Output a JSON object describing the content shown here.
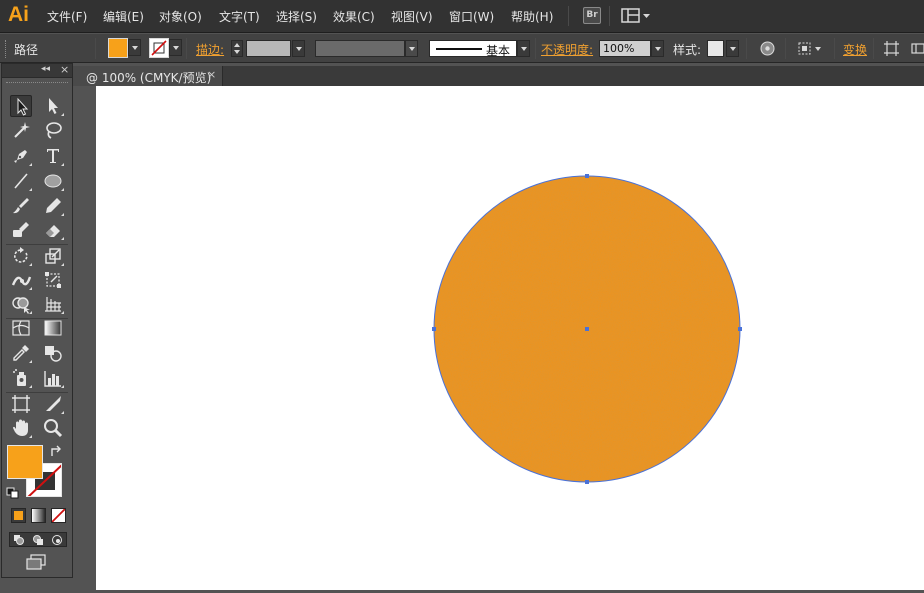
{
  "app": {
    "logo": "Ai",
    "bridge_label": "Br"
  },
  "menu": [
    "文件(F)",
    "编辑(E)",
    "对象(O)",
    "文字(T)",
    "选择(S)",
    "效果(C)",
    "视图(V)",
    "窗口(W)",
    "帮助(H)"
  ],
  "control_bar": {
    "selection_type": "路径",
    "fill_color": "#f7a11a",
    "stroke_label": "描边:",
    "stroke_profile_label": "基本",
    "opacity_label": "不透明度:",
    "opacity_value": "100%",
    "style_label": "样式:",
    "transform_label": "变换"
  },
  "document_tab": {
    "title": "@ 100% (CMYK/预览)",
    "close_glyph": "×"
  },
  "tools_panel": {
    "collapse_glyph": "◂◂",
    "close_glyph": "×",
    "fill_color": "#f7a11a",
    "stroke_color": "none"
  },
  "canvas": {
    "shape": "circle",
    "fill_color": "#f0911d",
    "anchor_color": "#4a72d8"
  },
  "colors": {
    "accent": "#f7a21b",
    "panel_bg": "#535353",
    "bar_bg": "#424242",
    "menubar_bg": "#323232"
  }
}
